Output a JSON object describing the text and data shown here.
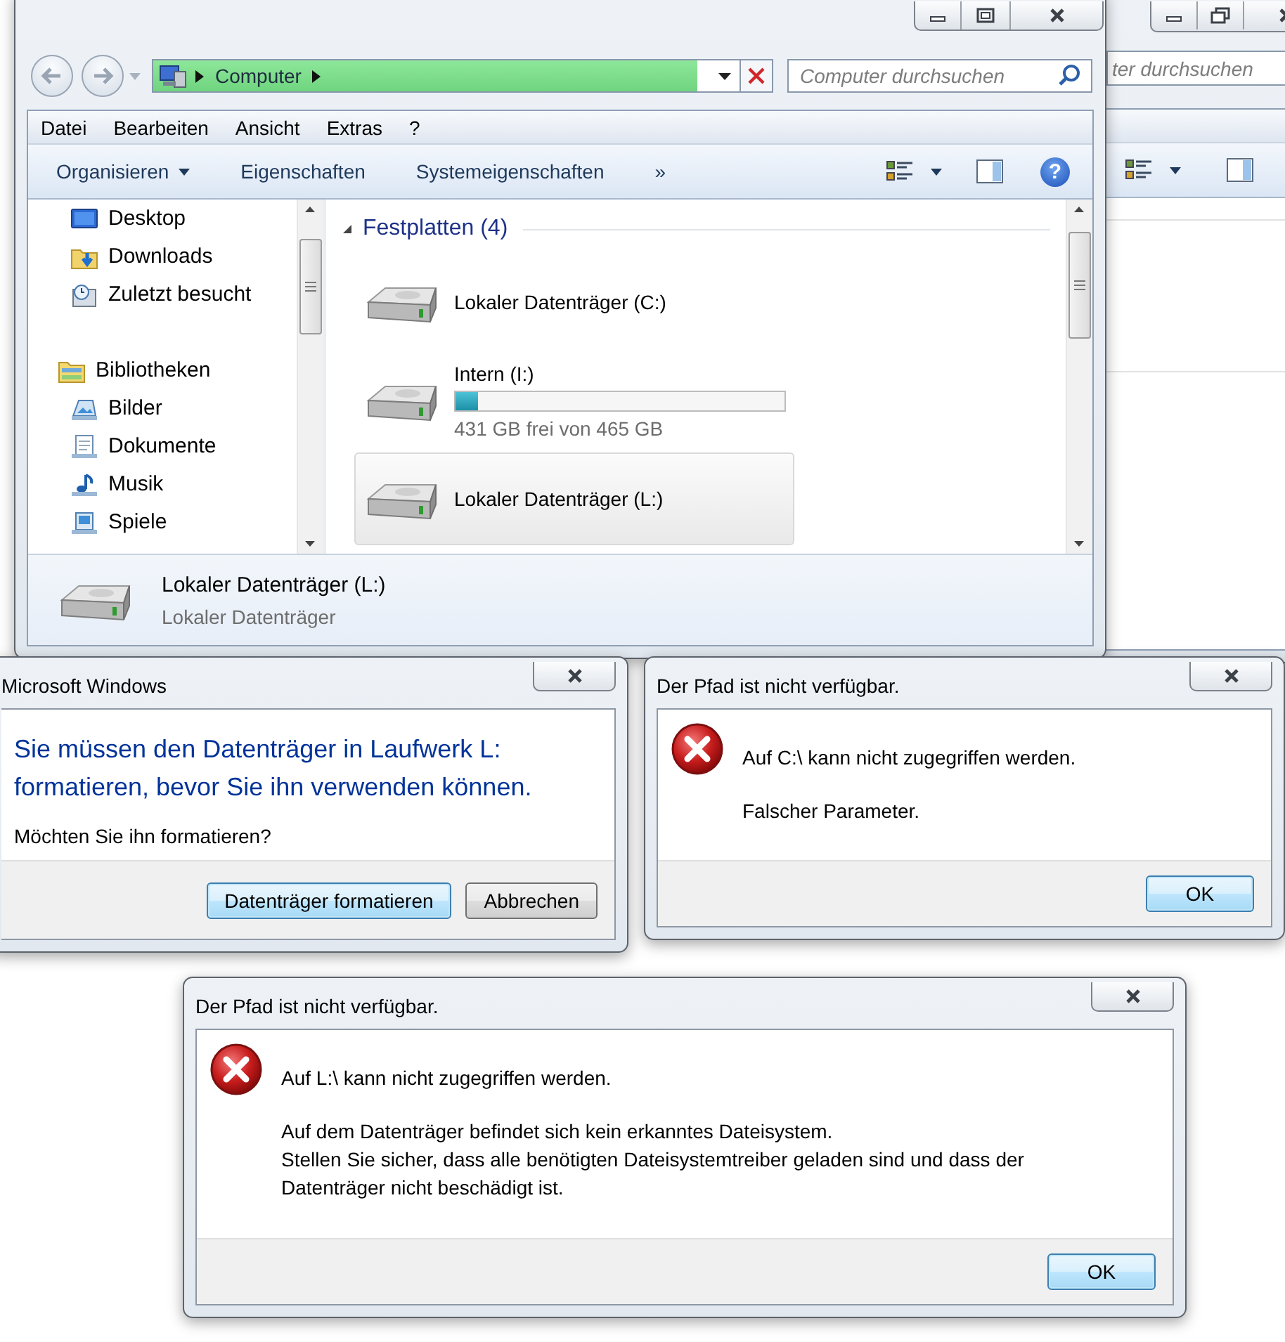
{
  "background_window": {
    "search_placeholder": "ter durchsuchen"
  },
  "explorer": {
    "address": {
      "level": 0.98,
      "path": [
        "Computer"
      ]
    },
    "search": {
      "placeholder": "Computer durchsuchen"
    },
    "menu": [
      "Datei",
      "Bearbeiten",
      "Ansicht",
      "Extras",
      "?"
    ],
    "toolbar": [
      {
        "label": "Organisieren",
        "kind": "dropdown"
      },
      {
        "label": "Eigenschaften",
        "kind": "button"
      },
      {
        "label": "Systemeigenschaften",
        "kind": "button"
      },
      {
        "label": "»",
        "kind": "more"
      }
    ],
    "help_icon": "?",
    "navigation": [
      {
        "children": [
          {
            "label": "Desktop",
            "kind": "desktop"
          },
          {
            "label": "Downloads",
            "kind": "downloads"
          },
          {
            "label": "Zuletzt besucht",
            "kind": "recent"
          }
        ]
      },
      {
        "label": "Bibliotheken",
        "kind": "library",
        "children": [
          {
            "label": "Bilder",
            "kind": "pictures"
          },
          {
            "label": "Dokumente",
            "kind": "documents"
          },
          {
            "label": "Musik",
            "kind": "music"
          },
          {
            "label": "Spiele",
            "kind": "games"
          }
        ]
      }
    ],
    "section": {
      "label": "Festplatten (4)",
      "expanded": true
    },
    "drives": [
      {
        "label": "Lokaler Datenträger (C:)",
        "selected": false
      },
      {
        "label": "Intern (I:)",
        "selected": false,
        "level": 0.07,
        "free": "431 GB frei von 465 GB"
      },
      {
        "label": "Lokaler Datenträger (L:)",
        "selected": true
      }
    ],
    "details": {
      "title": "Lokaler Datenträger (L:)",
      "subtitle": "Lokaler Datenträger"
    }
  },
  "format_dialog": {
    "title": "Microsoft Windows",
    "heading": "Sie müssen den Datenträger in Laufwerk L: formatieren, bevor Sie ihn verwenden können.",
    "question": "Möchten Sie ihn formatieren?",
    "buttons": [
      {
        "label": "Datenträger formatieren",
        "default": true
      },
      {
        "label": "Abbrechen",
        "default": false
      }
    ]
  },
  "error_dialogs": [
    {
      "title": "Der Pfad ist nicht verfügbar.",
      "message": "Auf C:\\ kann nicht zugegriffen werden.",
      "details": [
        "Falscher Parameter."
      ],
      "buttons": [
        {
          "label": "OK",
          "default": true
        }
      ]
    },
    {
      "title": "Der Pfad ist nicht verfügbar.",
      "message": "Auf L:\\ kann nicht zugegriffen werden.",
      "details": [
        "Auf dem Datenträger befindet sich kein erkanntes Dateisystem.",
        "Stellen Sie sicher, dass alle benötigten Dateisystemtreiber geladen sind und dass der Datenträger nicht beschädigt ist."
      ],
      "buttons": [
        {
          "label": "OK",
          "default": true
        }
      ]
    }
  ]
}
